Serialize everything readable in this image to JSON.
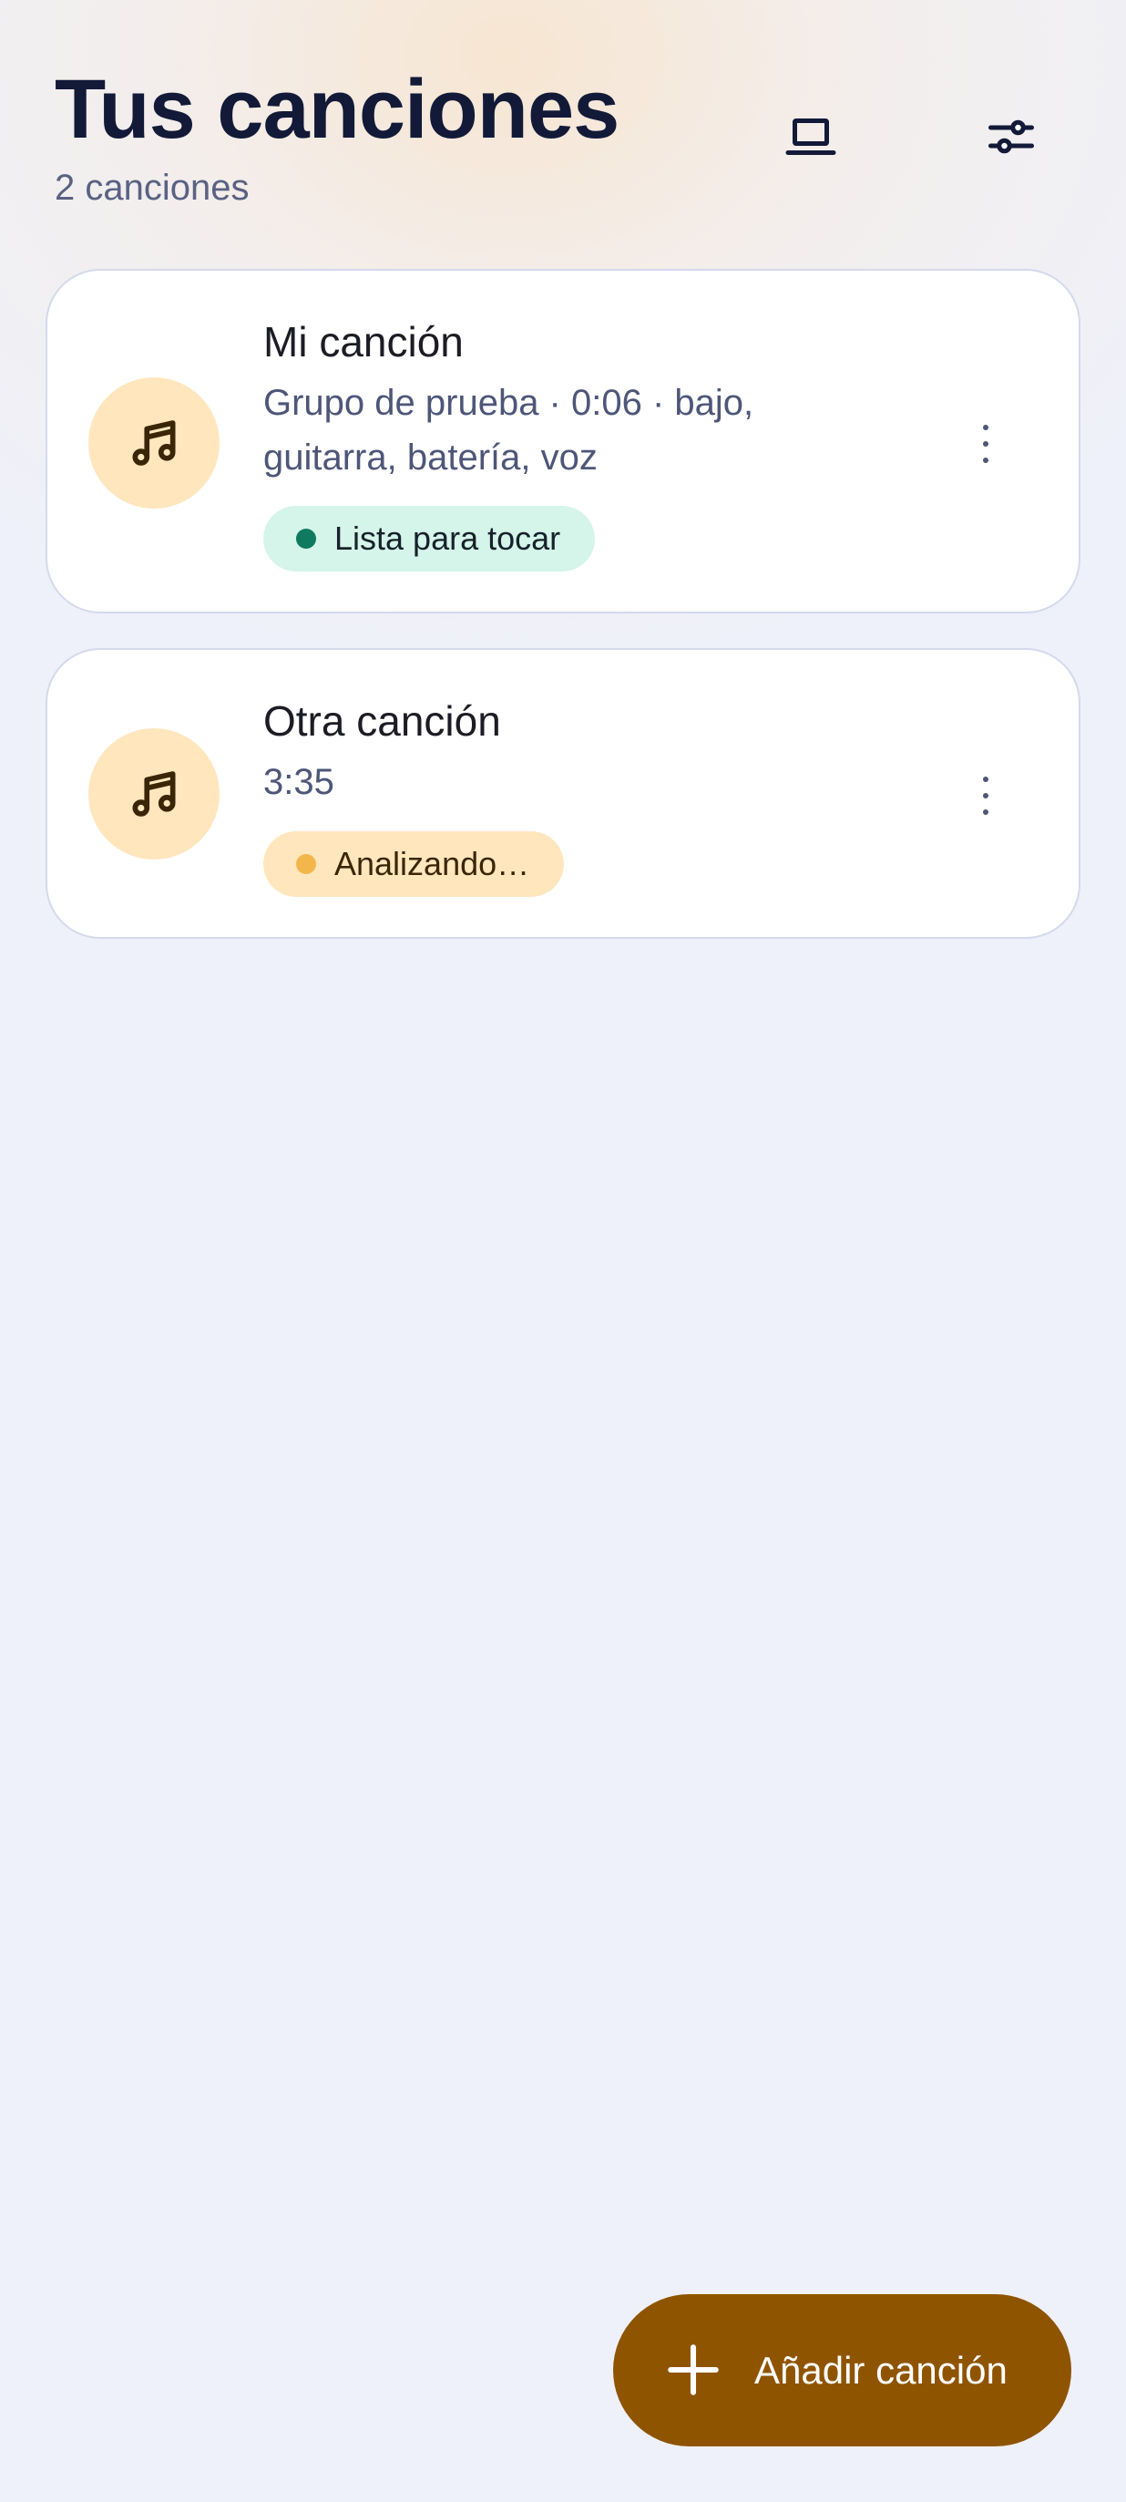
{
  "header": {
    "title": "Tus canciones",
    "subtitle": "2 canciones",
    "icons": [
      "laptop-icon",
      "tune-icon"
    ]
  },
  "songs": [
    {
      "title": "Mi canción",
      "meta": "Grupo de prueba · 0:06 · bajo, guitarra, batería, voz",
      "status": "Lista para tocar",
      "status_color": "#0f7a60",
      "status_bg": "#d5f4ea"
    },
    {
      "title": "Otra canción",
      "meta": "3:35",
      "status": "Analizando…",
      "status_color": "#f3b64b",
      "status_bg": "#ffe6bd"
    }
  ],
  "fab": {
    "label": "Añadir canción",
    "icon": "plus-icon",
    "color": "#8f5400"
  },
  "colors": {
    "title": "#121a38",
    "accent_avatar": "#ffe6bd"
  }
}
